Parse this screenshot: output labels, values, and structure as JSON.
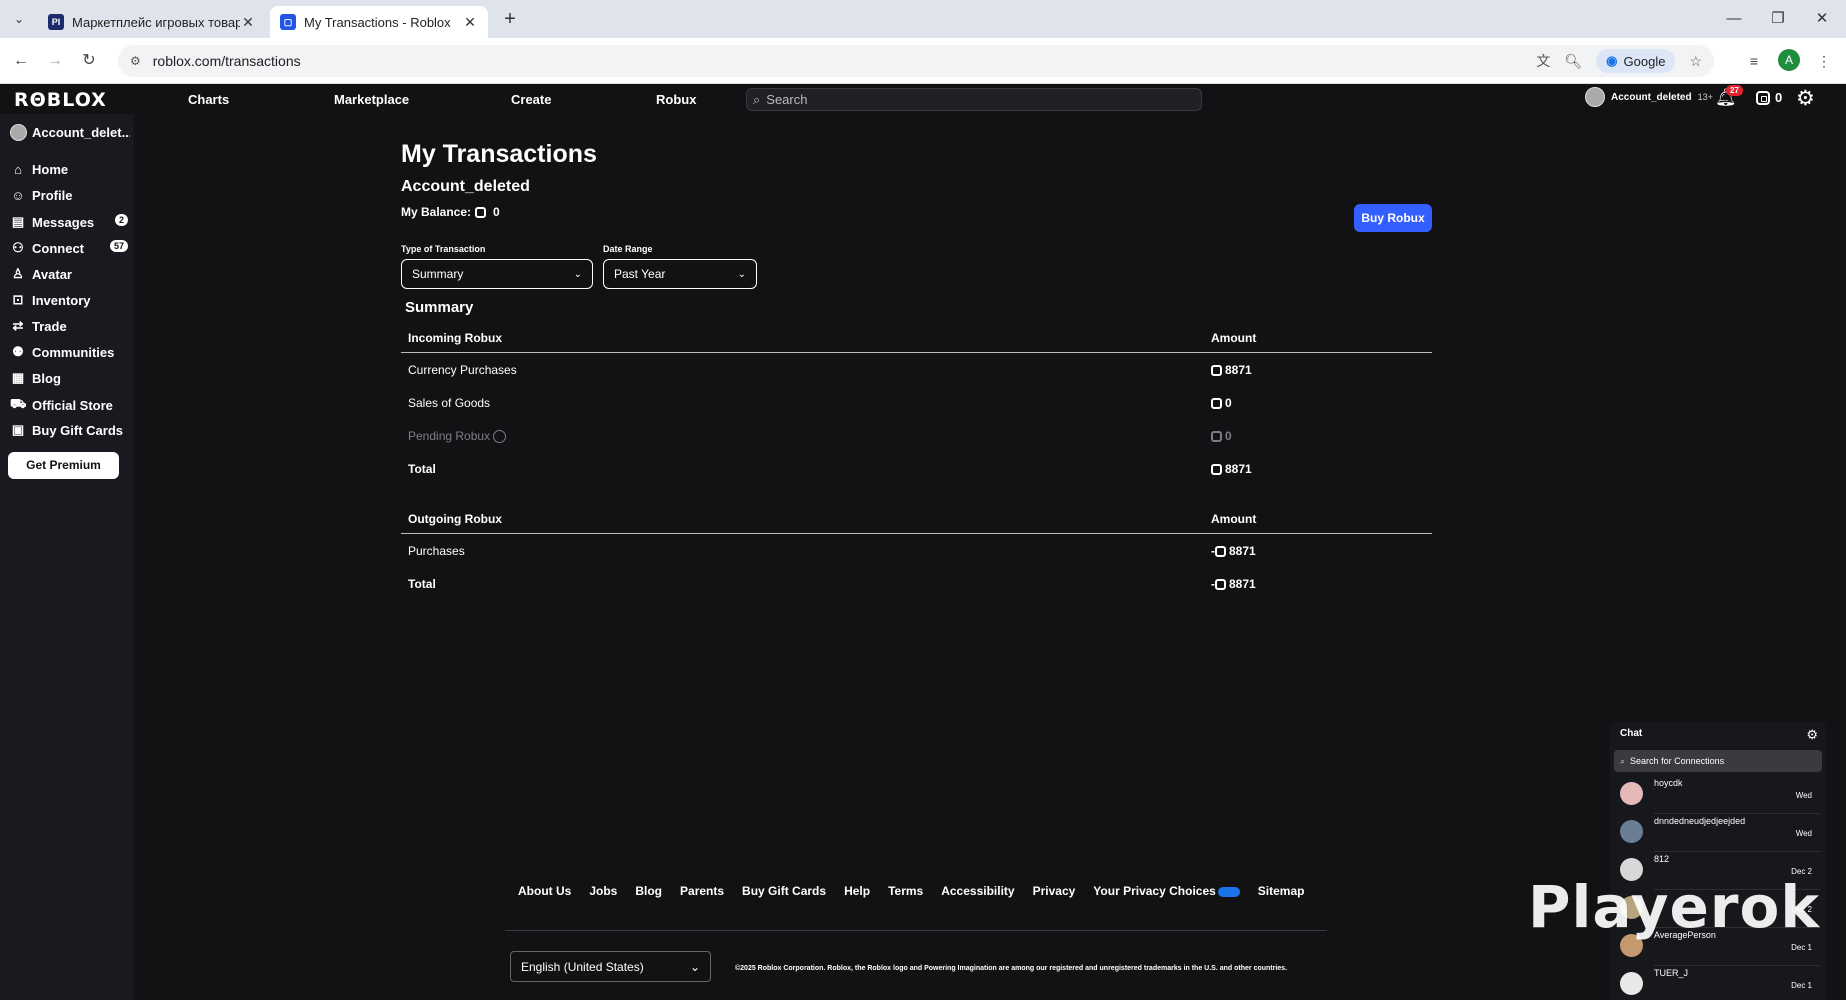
{
  "browser": {
    "tabs": [
      {
        "title": "Маркетплейс игровых товаро",
        "favicon": "PI"
      },
      {
        "title": "My Transactions - Roblox",
        "favicon": "roblox-icon"
      }
    ],
    "url": "roblox.com/transactions",
    "search_engine": "Google",
    "profile_initial": "A"
  },
  "topnav": {
    "logo": "RΘBLOX",
    "links": [
      "Charts",
      "Marketplace",
      "Create",
      "Robux"
    ],
    "search_placeholder": "Search",
    "username": "Account_deleted",
    "age": "13+",
    "notifications": "27",
    "robux": "0"
  },
  "sidebar": {
    "username": "Account_delet...",
    "items": [
      {
        "label": "Home",
        "icon": "home-icon"
      },
      {
        "label": "Profile",
        "icon": "profile-icon"
      },
      {
        "label": "Messages",
        "icon": "messages-icon",
        "badge": "2"
      },
      {
        "label": "Connect",
        "icon": "connect-icon",
        "badge": "57"
      },
      {
        "label": "Avatar",
        "icon": "avatar-icon"
      },
      {
        "label": "Inventory",
        "icon": "inventory-icon"
      },
      {
        "label": "Trade",
        "icon": "trade-icon"
      },
      {
        "label": "Communities",
        "icon": "communities-icon"
      },
      {
        "label": "Blog",
        "icon": "blog-icon"
      },
      {
        "label": "Official Store",
        "icon": "store-icon"
      },
      {
        "label": "Buy Gift Cards",
        "icon": "gift-card-icon"
      }
    ],
    "premium_label": "Get Premium"
  },
  "main": {
    "title": "My Transactions",
    "account": "Account_deleted",
    "balance_label": "My Balance:",
    "balance_value": "0",
    "buy_robux_label": "Buy Robux",
    "filters": {
      "type_label": "Type of Transaction",
      "type_value": "Summary",
      "range_label": "Date Range",
      "range_value": "Past Year"
    },
    "summary_heading": "Summary",
    "incoming": {
      "header": "Incoming Robux",
      "amount_header": "Amount",
      "rows": [
        {
          "label": "Currency Purchases",
          "amount": "8871"
        },
        {
          "label": "Sales of Goods",
          "amount": "0"
        },
        {
          "label": "Pending Robux",
          "amount": "0"
        },
        {
          "label": "Total",
          "amount": "8871"
        }
      ]
    },
    "outgoing": {
      "header": "Outgoing Robux",
      "amount_header": "Amount",
      "rows": [
        {
          "label": "Purchases",
          "amount": "8871",
          "sign": "-"
        },
        {
          "label": "Total",
          "amount": "8871",
          "sign": "-"
        }
      ]
    }
  },
  "footer": {
    "links": [
      "About Us",
      "Jobs",
      "Blog",
      "Parents",
      "Buy Gift Cards",
      "Help",
      "Terms",
      "Accessibility",
      "Privacy",
      "Your Privacy Choices",
      "Sitemap"
    ],
    "language": "English (United States)",
    "copyright": "©2025 Roblox Corporation. Roblox, the Roblox logo and Powering Imagination are among our registered and unregistered trademarks in the U.S. and other countries."
  },
  "chat": {
    "title": "Chat",
    "search_placeholder": "Search for Connections",
    "items": [
      {
        "name": "hoycdk",
        "when": "Wed"
      },
      {
        "name": "dnndedneudjedjeejded",
        "when": "Wed"
      },
      {
        "name": "812",
        "when": "Dec 2"
      },
      {
        "name": "",
        "when": "Dec 2"
      },
      {
        "name": "AveragePerson",
        "when": "Dec 1"
      },
      {
        "name": "TUER_J",
        "when": "Dec 1"
      }
    ]
  },
  "watermark": "Playerok",
  "colors": {
    "accent": "#335fff",
    "background": "#121215",
    "sidebar": "#191a1f"
  }
}
